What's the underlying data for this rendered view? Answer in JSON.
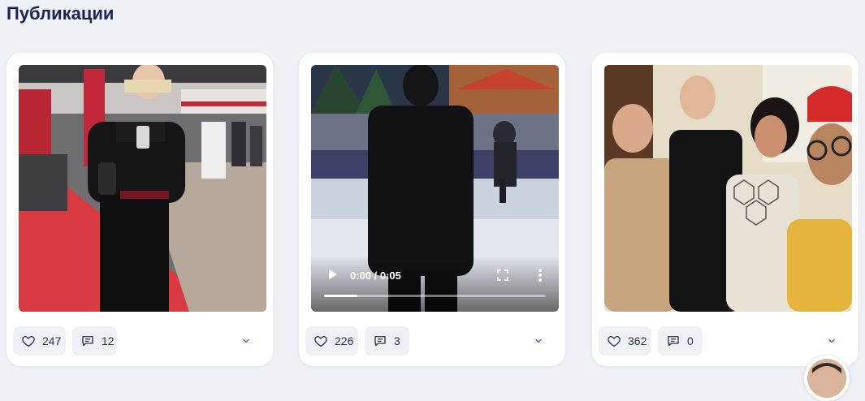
{
  "section": {
    "title": "Публикации"
  },
  "posts": [
    {
      "likes": "247",
      "comments": "12",
      "kind": "photo",
      "description_icon": "gym-mirror-selfie"
    },
    {
      "likes": "226",
      "comments": "3",
      "kind": "video",
      "video": {
        "time": "0:00 / 0:05",
        "progress": 0.0
      }
    },
    {
      "likes": "362",
      "comments": "0",
      "kind": "photo",
      "description_icon": "group-photo"
    }
  ],
  "icons": {
    "like": "heart-icon",
    "comment": "comment-icon",
    "expand": "chevron-down-icon"
  },
  "colors": {
    "title": "#1a2352",
    "pill_bg": "#eef1f6",
    "chevron": "#3b6fd6"
  }
}
